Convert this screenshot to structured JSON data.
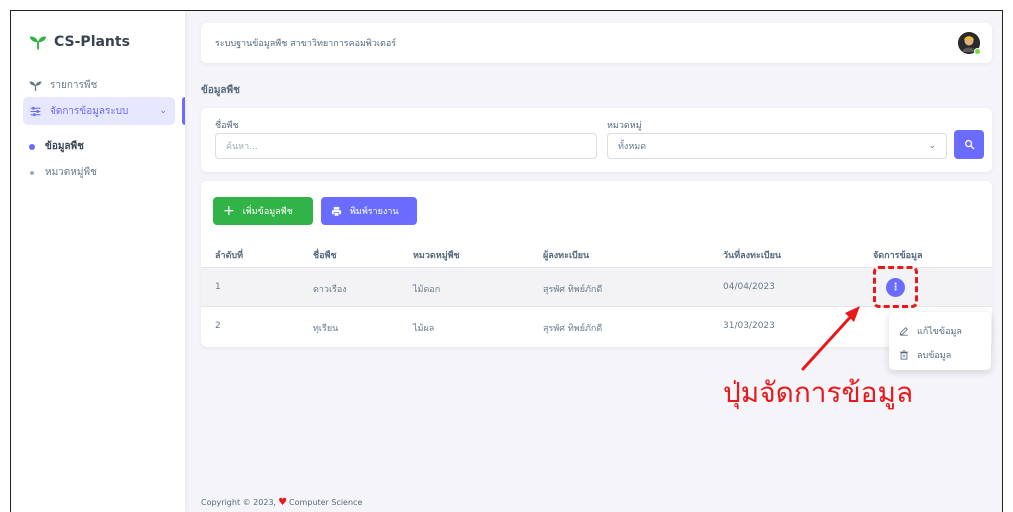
{
  "app": {
    "name": "CS-Plants"
  },
  "sidebar": {
    "items": [
      {
        "label": "รายการพืช"
      },
      {
        "label": "จัดการข้อมูลระบบ"
      }
    ],
    "subitems": [
      {
        "label": "ข้อมูลพืช"
      },
      {
        "label": "หมวดหมู่พืช"
      }
    ]
  },
  "navbar": {
    "title": "ระบบฐานข้อมูลพืช สาขาวิทยาการคอมพิวเตอร์"
  },
  "page": {
    "title": "ข้อมูลพืช"
  },
  "filter": {
    "name_label": "ชื่อพืช",
    "name_placeholder": "ค้นหา...",
    "category_label": "หมวดหมู่",
    "category_value": "ทั้งหมด"
  },
  "toolbar": {
    "add_label": "เพิ่มข้อมูลพืช",
    "print_label": "พิมพ์รายงาน"
  },
  "table": {
    "headers": [
      "ลำดับที่",
      "ชื่อพืช",
      "หมวดหมู่พืช",
      "ผู้ลงทะเบียน",
      "วันที่ลงทะเบียน",
      "จัดการข้อมูล"
    ],
    "rows": [
      {
        "no": "1",
        "name": "ดาวเรือง",
        "category": "ไม้ดอก",
        "registrant": "สุรพัศ ทิพย์ภักดี",
        "date": "04/04/2023"
      },
      {
        "no": "2",
        "name": "ทุเรียน",
        "category": "ไม้ผล",
        "registrant": "สุรพัศ ทิพย์ภักดี",
        "date": "31/03/2023"
      }
    ]
  },
  "dropdown": {
    "edit_label": "แก้ไขข้อมูล",
    "delete_label": "ลบข้อมูล"
  },
  "annotation": {
    "text": "ปุ่มจัดการข้อมูล"
  },
  "footer": {
    "prefix": "Copyright © 2023,",
    "suffix": "Computer Science"
  },
  "colors": {
    "primary": "#696cff",
    "success": "#32b347",
    "annotation": "#e8181b",
    "background": "#f5f5f9"
  }
}
